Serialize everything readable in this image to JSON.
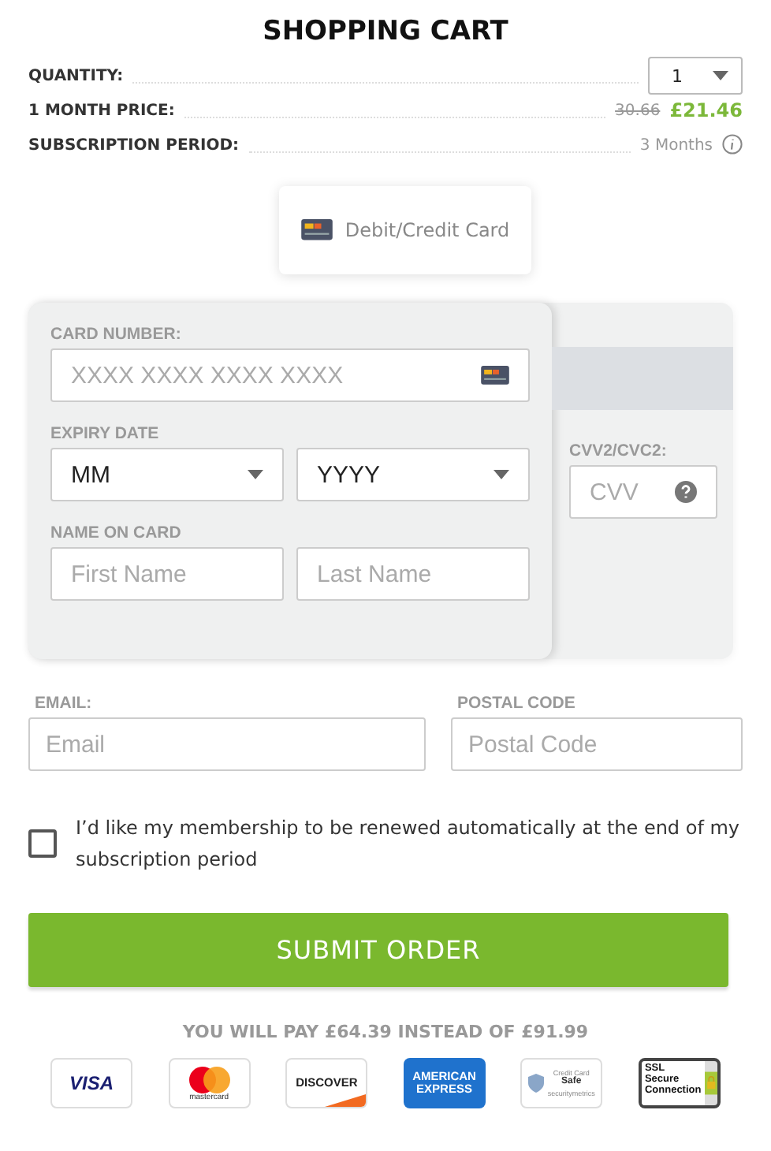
{
  "title": "SHOPPING CART",
  "summary": [
    {
      "kind": "select",
      "label": "QUANTITY:",
      "value": "1"
    },
    {
      "kind": "price",
      "label": "1 MONTH PRICE:",
      "old": "30.66",
      "value": "£21.46"
    },
    {
      "kind": "info",
      "label": "SUBSCRIPTION PERIOD:",
      "value": "3 Months"
    }
  ],
  "payment_methods": [
    {
      "label": "Debit/Credit Card",
      "selected": true
    }
  ],
  "card": {
    "number": {
      "label": "CARD NUMBER:",
      "placeholder": "XXXX XXXX XXXX XXXX"
    },
    "expiry": {
      "label": "EXPIRY DATE",
      "month": "MM",
      "year": "YYYY"
    },
    "name": {
      "label": "NAME ON CARD",
      "first": "First Name",
      "last": "Last Name"
    },
    "cvv": {
      "label": "CVV2/CVC2:",
      "placeholder": "CVV"
    }
  },
  "contact": [
    {
      "label": "EMAIL:",
      "placeholder": "Email"
    },
    {
      "label": "POSTAL CODE",
      "placeholder": "Postal Code"
    }
  ],
  "renew": {
    "label": "I’d like my membership to be renewed automatically at the end of my subscription period",
    "checked": false
  },
  "submit": "SUBMIT ORDER",
  "pay_note": "YOU WILL PAY £64.39 INSTEAD OF £91.99",
  "badges": [
    {
      "kind": "visa",
      "lines": [
        "VISA"
      ]
    },
    {
      "kind": "mastercard",
      "lines": [
        "mastercard"
      ]
    },
    {
      "kind": "discover",
      "lines": [
        "DISCOVER"
      ]
    },
    {
      "kind": "amex",
      "lines": [
        "AMERICAN",
        "EXPRESS"
      ]
    },
    {
      "kind": "security",
      "lines": [
        "Credit Card",
        "Safe",
        "securitymetrics"
      ]
    },
    {
      "kind": "ssl",
      "lines": [
        "SSL",
        "Secure",
        "Connection"
      ]
    }
  ]
}
